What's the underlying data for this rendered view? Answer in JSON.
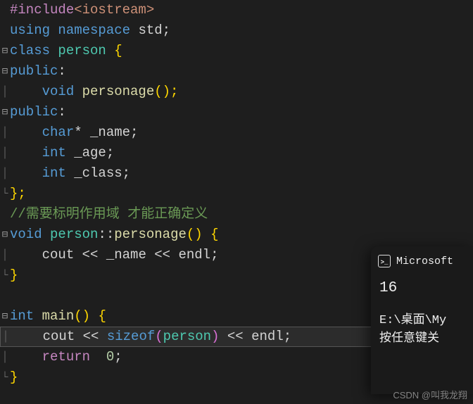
{
  "code": {
    "l1_directive": "#include",
    "l1_header": "<iostream>",
    "l2_using": "using",
    "l2_namespace": "namespace",
    "l2_std": "std",
    "l2_semi": ";",
    "l3_class": "class",
    "l3_name": "person",
    "l3_brace": " {",
    "l4_public": "public",
    "l4_colon": ":",
    "l5_void": "    void",
    "l5_func": " personage",
    "l5_parens": "();",
    "l6_public": "public",
    "l6_colon": ":",
    "l7_char": "    char",
    "l7_rest": "* _name;",
    "l8_int": "    int",
    "l8_rest": " _age;",
    "l9_int": "    int",
    "l9_rest": " _class;",
    "l10_close": "};",
    "l11_comment": "//需要标明作用域 才能正确定义",
    "l12_void": "void",
    "l12_class": " person",
    "l12_scope": "::",
    "l12_func": "personage",
    "l12_parens": "()",
    "l12_brace": " {",
    "l13_cout": "    cout ",
    "l13_op1": "<<",
    "l13_name": " _name ",
    "l13_op2": "<<",
    "l13_endl": " endl",
    "l13_semi": ";",
    "l14_close": "}",
    "l16_int": "int",
    "l16_main": " main",
    "l16_parens": "()",
    "l16_brace": " {",
    "l17_cout": "    cout ",
    "l17_op1": "<<",
    "l17_sizeof": " sizeof",
    "l17_pl": "(",
    "l17_person": "person",
    "l17_pr": ")",
    "l17_op2": " <<",
    "l17_endl": " endl",
    "l17_semi": ";",
    "l18_return": "    return",
    "l18_zero": "  0",
    "l18_semi": ";",
    "l19_close": "}"
  },
  "console": {
    "title": "Microsoft",
    "output": "16",
    "path": "E:\\桌面\\My",
    "prompt": "按任意键关"
  },
  "watermark": "CSDN @叫我龙翔"
}
